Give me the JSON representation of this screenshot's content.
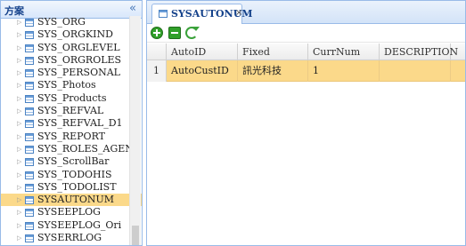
{
  "left_panel": {
    "title": "方案",
    "collapse_glyph": "«",
    "tree_items": [
      {
        "label": "SYS_ORG",
        "selected": false
      },
      {
        "label": "SYS_ORGKIND",
        "selected": false
      },
      {
        "label": "SYS_ORGLEVEL",
        "selected": false
      },
      {
        "label": "SYS_ORGROLES",
        "selected": false
      },
      {
        "label": "SYS_PERSONAL",
        "selected": false
      },
      {
        "label": "SYS_Photos",
        "selected": false
      },
      {
        "label": "SYS_Products",
        "selected": false
      },
      {
        "label": "SYS_REFVAL",
        "selected": false
      },
      {
        "label": "SYS_REFVAL_D1",
        "selected": false
      },
      {
        "label": "SYS_REPORT",
        "selected": false
      },
      {
        "label": "SYS_ROLES_AGENT",
        "selected": false
      },
      {
        "label": "SYS_ScrollBar",
        "selected": false
      },
      {
        "label": "SYS_TODOHIS",
        "selected": false
      },
      {
        "label": "SYS_TODOLIST",
        "selected": false
      },
      {
        "label": "SYSAUTONUM",
        "selected": true
      },
      {
        "label": "SYSEEPLOG",
        "selected": false
      },
      {
        "label": "SYSEEPLOG_Ori",
        "selected": false
      },
      {
        "label": "SYSERRLOG",
        "selected": false
      }
    ]
  },
  "tab": {
    "label": "SYSAUTONUM",
    "close_glyph": "×"
  },
  "toolbar": {
    "icons": [
      "add-icon",
      "remove-icon",
      "refresh-icon"
    ]
  },
  "grid": {
    "columns": [
      "AutoID",
      "Fixed",
      "CurrNum",
      "DESCRIPTION"
    ],
    "rows": [
      {
        "num": "1",
        "AutoID": "AutoCustID",
        "Fixed": "訊光科技",
        "CurrNum": "1",
        "DESCRIPTION": ""
      }
    ]
  },
  "colors": {
    "selected_row": "#fbd98a",
    "panel_border": "#99bbe8",
    "header_text": "#15428b",
    "toolbar_green": "#31a02a"
  }
}
